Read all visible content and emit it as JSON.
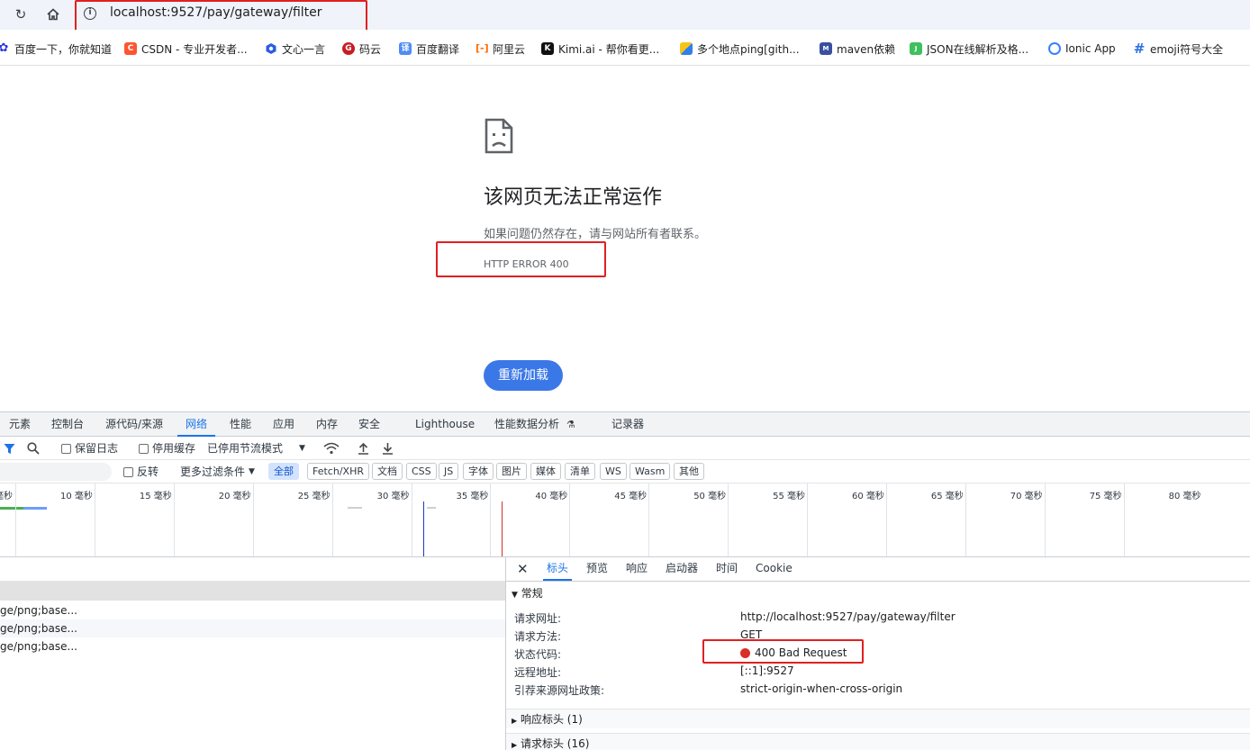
{
  "browser": {
    "url_host": "localhost",
    "url_rest": ":9527/pay/gateway/filter"
  },
  "bookmarks": [
    {
      "label": "百度一下，你就知道",
      "icon": "baidu-paw-icon",
      "color": "#2932e1"
    },
    {
      "label": "CSDN - 专业开发者...",
      "icon": "csdn-icon",
      "color": "#fc5531",
      "glyph": "C"
    },
    {
      "label": "文心一言",
      "icon": "wenxin-icon",
      "color": "#2b5ce6"
    },
    {
      "label": "码云",
      "icon": "gitee-icon",
      "color": "#c71d23",
      "glyph": "G"
    },
    {
      "label": "百度翻译",
      "icon": "baidu-translate-icon",
      "color": "#4e8df5",
      "glyph": "译"
    },
    {
      "label": "阿里云",
      "icon": "aliyun-icon",
      "color": "#ff6a00"
    },
    {
      "label": "Kimi.ai - 帮你看更...",
      "icon": "kimi-icon",
      "color": "#111111",
      "glyph": "K"
    },
    {
      "label": "多个地点ping[gith...",
      "icon": "ping-icon",
      "color": "#2f80ed"
    },
    {
      "label": "maven依赖",
      "icon": "maven-icon",
      "color": "#3a4fa0",
      "glyph": "M"
    },
    {
      "label": "JSON在线解析及格...",
      "icon": "json-icon",
      "color": "#3fbf5f",
      "glyph": "J"
    },
    {
      "label": "Ionic App",
      "icon": "ionic-icon",
      "color": "#3880ff"
    },
    {
      "label": "emoji符号大全",
      "icon": "hash-icon",
      "color": "#2f6fe0",
      "glyph": "#"
    }
  ],
  "error_page": {
    "title": "该网页无法正常运作",
    "message": "如果问题仍然存在，请与网站所有者联系。",
    "code": "HTTP ERROR 400",
    "reload_label": "重新加载"
  },
  "devtools": {
    "tabs": [
      "元素",
      "控制台",
      "源代码/来源",
      "网络",
      "性能",
      "应用",
      "内存",
      "安全",
      "Lighthouse",
      "性能数据分析",
      "记录器"
    ],
    "active_tab": "网络",
    "toolbar": {
      "preserve_log": "保留日志",
      "disable_cache": "停用缓存",
      "throttling": "已停用节流模式"
    },
    "filter": {
      "invert": "反转",
      "more_filters": "更多过滤条件",
      "types": [
        "全部",
        "Fetch/XHR",
        "文档",
        "CSS",
        "JS",
        "字体",
        "图片",
        "媒体",
        "清单",
        "WS",
        "Wasm",
        "其他"
      ]
    },
    "timeline_ticks": [
      "10 毫秒",
      "15 毫秒",
      "20 毫秒",
      "25 毫秒",
      "30 毫秒",
      "35 毫秒",
      "40 毫秒",
      "45 毫秒",
      "50 毫秒",
      "55 毫秒",
      "60 毫秒",
      "65 毫秒",
      "70 毫秒",
      "75 毫秒",
      "80 毫秒"
    ],
    "requests": [
      "ge/png;base...",
      "ge/png;base...",
      "ge/png;base..."
    ],
    "detail_tabs": [
      "标头",
      "预览",
      "响应",
      "启动器",
      "时间",
      "Cookie"
    ],
    "general": {
      "heading": "常规",
      "rows": [
        {
          "key": "请求网址:",
          "value": "http://localhost:9527/pay/gateway/filter"
        },
        {
          "key": "请求方法:",
          "value": "GET"
        },
        {
          "key": "状态代码:",
          "value": "400 Bad Request"
        },
        {
          "key": "远程地址:",
          "value": "[::1]:9527"
        },
        {
          "key": "引荐来源网址政策:",
          "value": "strict-origin-when-cross-origin"
        }
      ]
    },
    "response_headers": "响应标头 (1)",
    "request_headers": "请求标头 (16)"
  }
}
